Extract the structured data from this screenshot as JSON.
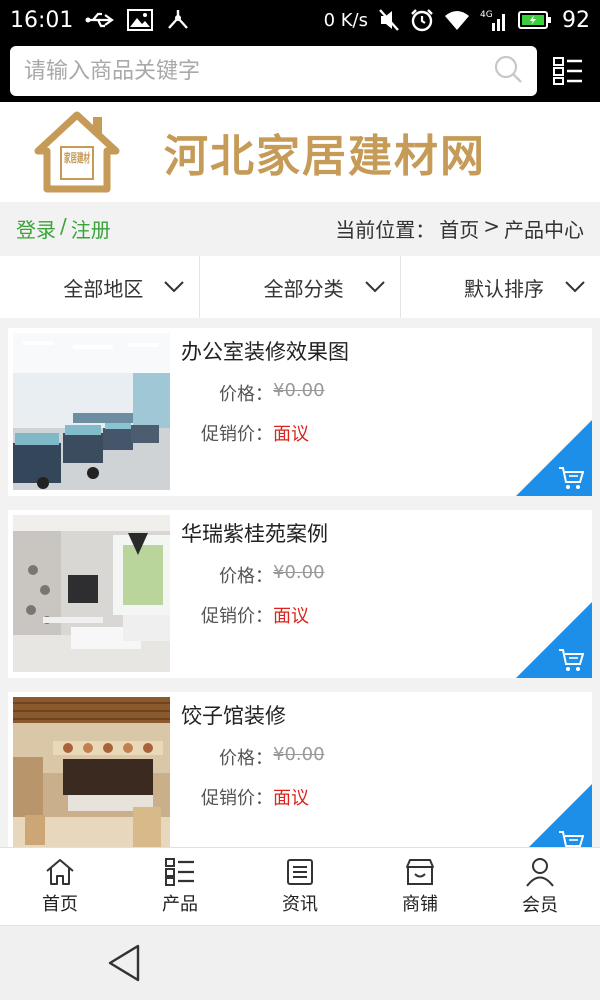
{
  "status_bar": {
    "time": "16:01",
    "net_speed": "0 K/s",
    "battery": "92",
    "signal_label": "4G"
  },
  "search": {
    "placeholder": "请输入商品关键字"
  },
  "banner": {
    "logo_text": "家居建材",
    "site_title": "河北家居建材网"
  },
  "infobar": {
    "login": "登录",
    "separator": "/",
    "register": "注册",
    "location_label": "当前位置：",
    "crumb_home": "首页",
    "crumb_sep": ">",
    "crumb_current": "产品中心"
  },
  "filters": [
    {
      "label": "全部地区"
    },
    {
      "label": "全部分类"
    },
    {
      "label": "默认排序"
    }
  ],
  "products": [
    {
      "name": "办公室装修效果图",
      "price_label": "价格：",
      "price": "¥0.00",
      "promo_label": "促销价：",
      "promo": "面议"
    },
    {
      "name": "华瑞紫桂苑案例",
      "price_label": "价格：",
      "price": "¥0.00",
      "promo_label": "促销价：",
      "promo": "面议"
    },
    {
      "name": "饺子馆装修",
      "price_label": "价格：",
      "price": "¥0.00",
      "promo_label": "促销价：",
      "promo": "面议"
    }
  ],
  "tabs": [
    {
      "label": "首页",
      "icon": "home-icon"
    },
    {
      "label": "产品",
      "icon": "list-icon"
    },
    {
      "label": "资讯",
      "icon": "news-icon"
    },
    {
      "label": "商铺",
      "icon": "shop-icon"
    },
    {
      "label": "会员",
      "icon": "user-icon"
    }
  ],
  "colors": {
    "accent_blue": "#1e8fe9",
    "login_green": "#3aa33a",
    "promo_red": "#d9251c",
    "brand_gold": "#c69a57"
  }
}
